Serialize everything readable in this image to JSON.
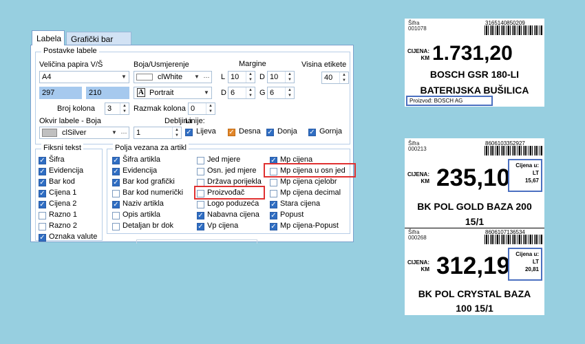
{
  "tabs": [
    {
      "label": "Labela",
      "active": true
    },
    {
      "label": "Grafički bar kod",
      "active": false
    }
  ],
  "postavke": {
    "legend": "Postavke labele",
    "size_label": "Veličina papira V/Š",
    "paper_size": "A4",
    "height": "297",
    "width": "210",
    "color_label": "Boja/Usmjerenje",
    "color": "clWhite",
    "orientation": "Portrait",
    "margins_label": "Margine",
    "margin_L_label": "L",
    "margin_L": "10",
    "margin_D_label": "D",
    "margin_D": "10",
    "margin_D2_label": "D",
    "margin_D2": "6",
    "margin_G_label": "G",
    "margin_G": "6",
    "label_height_label": "Visina etikete",
    "label_height": "40",
    "columns_label": "Broj kolona",
    "columns": "3",
    "column_gap_label": "Razmak kolona",
    "column_gap": "0",
    "frame_label": "Okvir labele  -  Boja",
    "frame_color": "clSilver",
    "thickness_label": "Debljina",
    "thickness": "1",
    "lines_label": "Linije:",
    "lines": [
      {
        "label": "Lijeva",
        "checked": true
      },
      {
        "label": "Desna",
        "checked": true
      },
      {
        "label": "Donja",
        "checked": true
      },
      {
        "label": "Gornja",
        "checked": true
      }
    ]
  },
  "fiksni": {
    "legend": "Fiksni tekst",
    "items": [
      {
        "label": "Šifra",
        "checked": true
      },
      {
        "label": "Evidencija",
        "checked": true
      },
      {
        "label": "Bar kod",
        "checked": true
      },
      {
        "label": "Cijena 1",
        "checked": true
      },
      {
        "label": "Cijena 2",
        "checked": true
      },
      {
        "label": "Razno 1",
        "checked": false
      },
      {
        "label": "Razno 2",
        "checked": false
      },
      {
        "label": "Oznaka valute",
        "checked": true
      }
    ]
  },
  "polja": {
    "legend": "Polja vezana za artikl",
    "col1": [
      {
        "label": "Šifra artikla",
        "checked": true
      },
      {
        "label": "Evidencija",
        "checked": true
      },
      {
        "label": "Bar kod grafički",
        "checked": true
      },
      {
        "label": "Bar kod numerički",
        "checked": false
      },
      {
        "label": "Naziv artikla",
        "checked": true
      },
      {
        "label": "Opis artikla",
        "checked": false
      },
      {
        "label": "Detaljan br dok",
        "checked": false
      }
    ],
    "col2": [
      {
        "label": "Jed mjere",
        "checked": false
      },
      {
        "label": "Osn. jed mjere",
        "checked": false
      },
      {
        "label": "Država porijekla",
        "checked": false
      },
      {
        "label": "Proizvođač",
        "checked": false
      },
      {
        "label": "Logo poduzeća",
        "checked": false
      },
      {
        "label": "Nabavna cijena",
        "checked": true
      },
      {
        "label": "Vp cijena",
        "checked": true
      }
    ],
    "col3": [
      {
        "label": "Mp cijena",
        "checked": true
      },
      {
        "label": "Mp cijena u osn jed",
        "checked": false
      },
      {
        "label": "Mp cijena cjelobr",
        "checked": false
      },
      {
        "label": "Mp cijena decimal",
        "checked": false
      },
      {
        "label": "Stara cijena",
        "checked": true
      },
      {
        "label": "Popust",
        "checked": true
      },
      {
        "label": "Mp cijena-Popust",
        "checked": true
      }
    ]
  },
  "label1": {
    "sifra_label": "Šifra",
    "sifra": "001078",
    "barcode": "3165140850209",
    "cijena_label": "CIJENA:",
    "currency": "KM",
    "price": "1.731,20",
    "name_line1": "BOSCH GSR 180-LI",
    "name_line2": "BATERIJSKA BUŠILICA",
    "producer_label": "Proizvođ:",
    "producer": "BOSCH AG"
  },
  "label2": {
    "sifra_label": "Šifra",
    "sifra": "000213",
    "barcode": "8606103352927",
    "cijena_label": "CIJENA:",
    "currency": "KM",
    "price": "235,10",
    "unit_label": "Cijena u:",
    "unit": "LT",
    "unit_price": "15,67",
    "name_line1": "BK POL GOLD BAZA 200",
    "name_line2": "15/1"
  },
  "label3": {
    "sifra_label": "Šifra",
    "sifra": "000268",
    "barcode": "8606107136534",
    "cijena_label": "CIJENA:",
    "currency": "KM",
    "price": "312,19",
    "unit_label": "Cijena u:",
    "unit": "LT",
    "unit_price": "20,81",
    "name_line1": "BK POL CRYSTAL BAZA",
    "name_line2": "100 15/1"
  }
}
